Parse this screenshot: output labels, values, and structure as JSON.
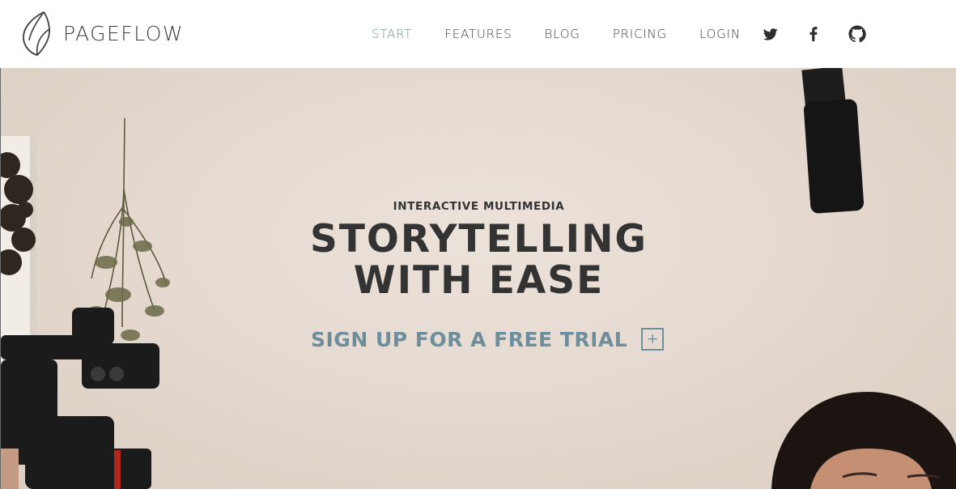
{
  "brand": {
    "name": "PAGEFLOW",
    "logo_icon": "feather-leaf-icon"
  },
  "nav": {
    "items": [
      {
        "label": "START",
        "active": true
      },
      {
        "label": "FEATURES",
        "active": false
      },
      {
        "label": "BLOG",
        "active": false
      },
      {
        "label": "PRICING",
        "active": false
      },
      {
        "label": "LOGIN",
        "active": false
      }
    ],
    "social": [
      "twitter-icon",
      "facebook-icon",
      "github-icon"
    ]
  },
  "hero": {
    "eyebrow": "INTERACTIVE MULTIMEDIA",
    "headline_line1": "STORYTELLING",
    "headline_line2": "WITH EASE",
    "cta_label": "SIGN UP FOR A FREE TRIAL",
    "cta_icon": "+"
  },
  "colors": {
    "accent": "#6f8e9b",
    "text_dark": "#333333",
    "hero_background": "#e7ddd4"
  }
}
